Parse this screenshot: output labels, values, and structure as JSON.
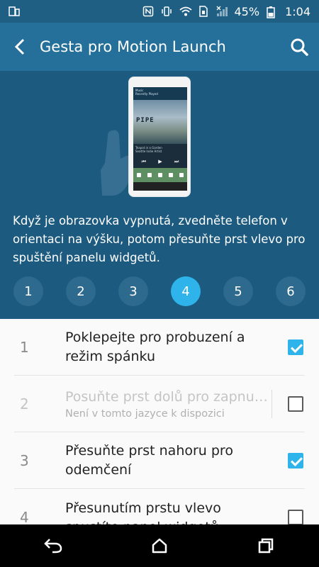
{
  "status_bar": {
    "battery": "45%",
    "time": "1:04",
    "icons": [
      "screen-mirror-icon",
      "nfc-icon",
      "vibrate-icon",
      "wifi-icon",
      "sim-icon",
      "signal-icon",
      "battery-icon"
    ]
  },
  "header": {
    "title": "Gesta pro Motion Launch"
  },
  "hero": {
    "screen_app_title": "Music",
    "screen_app_subtitle": "Recently Played",
    "album_title": "PIPE",
    "track_title": "Teapot in a Garden",
    "track_artist": "Seattle Indie Artist"
  },
  "instructions": {
    "text": "Když je obrazovka vypnutá, zvedněte telefon v orientaci na výšku, potom přesuňte prst vlevo pro spuštění panelu widgetů.",
    "steps": [
      "1",
      "2",
      "3",
      "4",
      "5",
      "6"
    ],
    "active_step": "4"
  },
  "gestures": [
    {
      "num": "1",
      "title": "Poklepejte pro probuzení a režim spánku",
      "subtitle": "",
      "checked": true,
      "enabled": true
    },
    {
      "num": "2",
      "title": "Posuňte prst dolů pro zapnu…",
      "subtitle": "Není v tomto jazyce k dispozici",
      "checked": false,
      "enabled": false
    },
    {
      "num": "3",
      "title": "Přesuňte prst nahoru pro odemčení",
      "subtitle": "",
      "checked": true,
      "enabled": true
    },
    {
      "num": "4",
      "title": "Přesunutím prstu vlevo spustíte panel widgetů",
      "subtitle": "",
      "checked": false,
      "enabled": true
    }
  ],
  "colors": {
    "accent": "#2eb4ea",
    "app_bar": "#25709a",
    "hero_bg": "#1c5a7f"
  },
  "nav_bar": {
    "icons": [
      "back-icon",
      "home-icon",
      "recents-icon"
    ]
  }
}
